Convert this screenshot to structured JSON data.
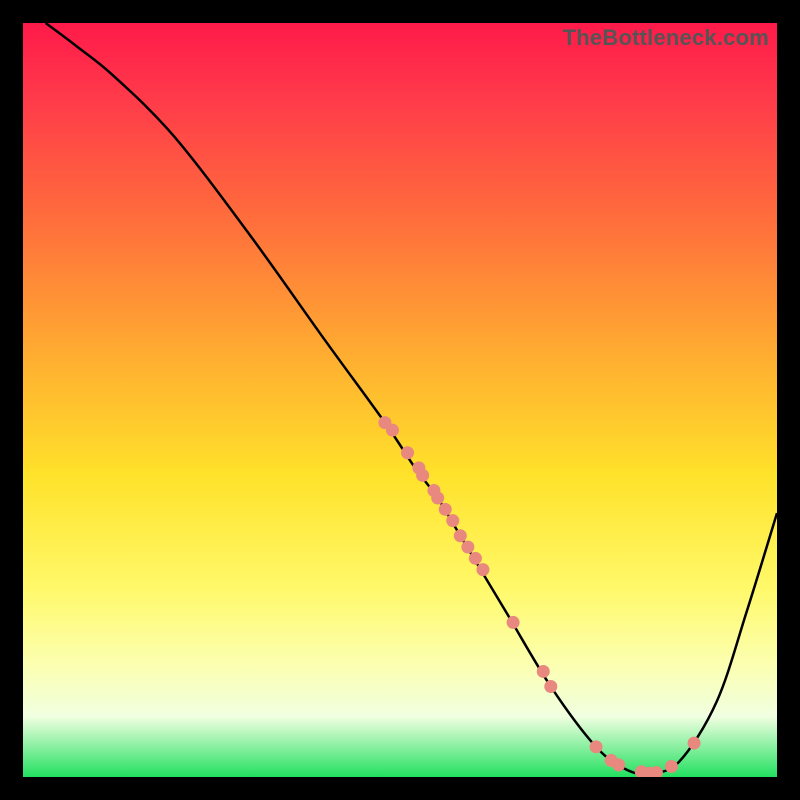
{
  "watermark": "TheBottleneck.com",
  "chart_data": {
    "type": "line",
    "title": "",
    "xlabel": "",
    "ylabel": "",
    "xlim": [
      0,
      100
    ],
    "ylim": [
      0,
      100
    ],
    "curve": {
      "name": "bottleneck-curve",
      "x": [
        3,
        7,
        12,
        20,
        30,
        40,
        48,
        52,
        55,
        58,
        64,
        70,
        76,
        80,
        83,
        87,
        92,
        96,
        100
      ],
      "y": [
        100,
        97,
        93,
        85,
        72,
        58,
        47,
        41,
        37,
        32,
        22,
        12,
        4,
        1,
        0.5,
        2,
        10,
        22,
        35
      ]
    },
    "points": {
      "name": "highlighted-points",
      "x": [
        48,
        49,
        51,
        52.5,
        53,
        54.5,
        55,
        56,
        57,
        58,
        59,
        60,
        61,
        65,
        69,
        70,
        76,
        78,
        79,
        82,
        83,
        84,
        86,
        89
      ],
      "y": [
        47,
        46,
        43,
        41,
        40,
        38,
        37,
        35.5,
        34,
        32,
        30.5,
        29,
        27.5,
        20.5,
        14,
        12,
        4,
        2.2,
        1.6,
        0.7,
        0.5,
        0.6,
        1.4,
        4.5
      ]
    }
  }
}
